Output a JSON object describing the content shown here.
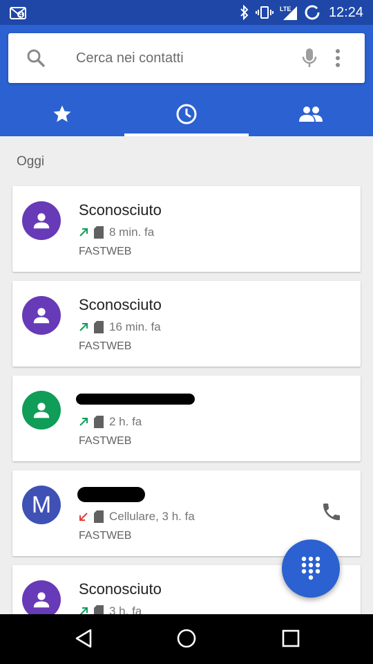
{
  "status_bar": {
    "time": "12:24",
    "network_label": "LTE",
    "notification_badge": "4",
    "icons": [
      "notification-icon",
      "bluetooth-icon",
      "vibrate-icon",
      "signal-icon",
      "battery-icon"
    ]
  },
  "search": {
    "placeholder": "Cerca nei contatti"
  },
  "tabs": [
    {
      "name": "favorites",
      "icon": "star-icon",
      "selected": false
    },
    {
      "name": "recents",
      "icon": "clock-icon",
      "selected": true
    },
    {
      "name": "contacts",
      "icon": "people-icon",
      "selected": false
    }
  ],
  "colors": {
    "status_bar": "#1f47a8",
    "app_bar": "#2b61d0",
    "avatar_purple": "#673ab7",
    "avatar_green": "#0f9d58",
    "avatar_indigo": "#3f51b5",
    "outgoing_arrow": "#0f9d58",
    "missed_arrow": "#e53935"
  },
  "section_header": "Oggi",
  "calls": [
    {
      "name": "Sconosciuto",
      "avatar_type": "person-icon",
      "avatar_color": "#673ab7",
      "direction": "outgoing",
      "time": "8 min. fa",
      "carrier": "FASTWEB",
      "redacted": false
    },
    {
      "name": "Sconosciuto",
      "avatar_type": "person-icon",
      "avatar_color": "#673ab7",
      "direction": "outgoing",
      "time": "16 min. fa",
      "carrier": "FASTWEB",
      "redacted": false
    },
    {
      "name": "",
      "avatar_type": "person-icon",
      "avatar_color": "#0f9d58",
      "direction": "outgoing",
      "time": "2 h. fa",
      "carrier": "FASTWEB",
      "redacted": true
    },
    {
      "name": "",
      "avatar_type": "letter",
      "avatar_letter": "M",
      "avatar_color": "#3f51b5",
      "direction": "missed",
      "time": "Cellulare, 3 h. fa",
      "carrier": "FASTWEB",
      "redacted": true,
      "has_call_button": true
    },
    {
      "name": "Sconosciuto",
      "avatar_type": "person-icon",
      "avatar_color": "#673ab7",
      "direction": "outgoing",
      "time": "3 h. fa",
      "carrier": "",
      "redacted": false
    }
  ],
  "fab": {
    "icon": "dialpad-icon"
  },
  "nav": {
    "buttons": [
      "back-icon",
      "home-icon",
      "recents-icon"
    ]
  }
}
